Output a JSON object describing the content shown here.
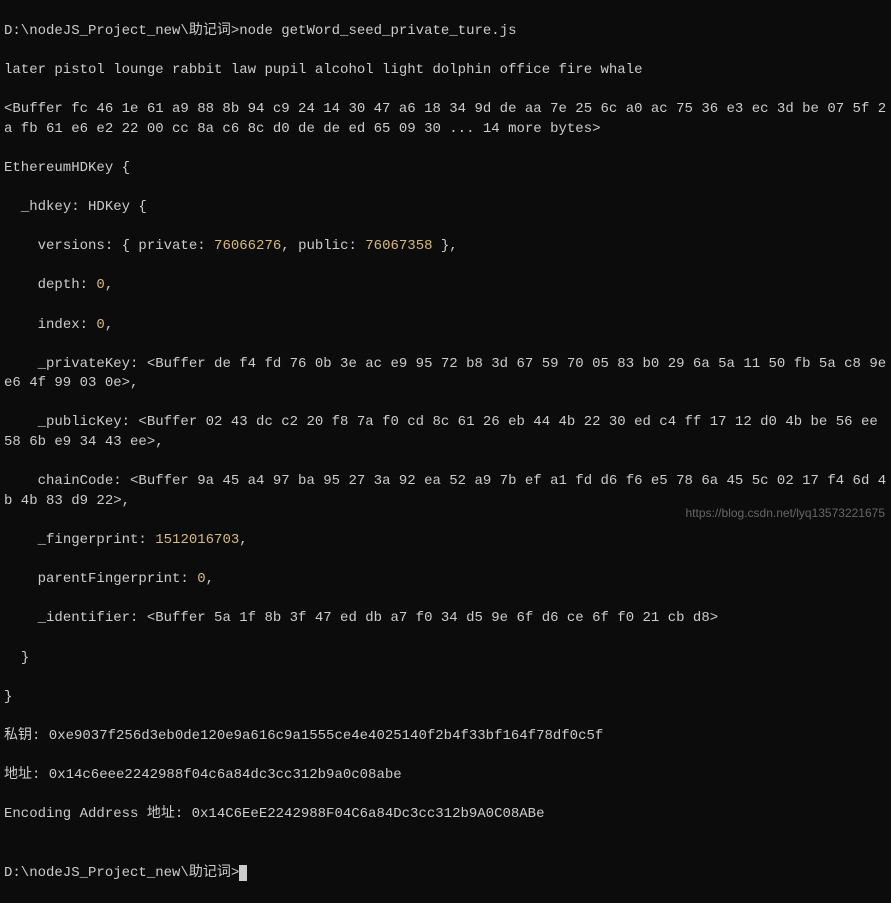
{
  "prompt1": "D:\\nodeJS_Project_new\\助记词>",
  "command": "node getWord_seed_private_ture.js",
  "mnemonic": "later pistol lounge rabbit law pupil alcohol light dolphin office fire whale",
  "buffer1": "<Buffer fc 46 1e 61 a9 88 8b 94 c9 24 14 30 47 a6 18 34 9d de aa 7e 25 6c a0 ac 75 36 e3 ec 3d be 07 5f 2a fb 61 e6 e2 22 00 cc 8a c6 8c d0 de de ed 65 09 30 ... 14 more bytes>",
  "objHeader": "EthereumHDKey {",
  "hdkeyLine": "  _hdkey: HDKey {",
  "versionsPre": "    versions: { private: ",
  "versionsNum1": "76066276",
  "versionsMid": ", public: ",
  "versionsNum2": "76067358",
  "versionsPost": " },",
  "depthPre": "    depth: ",
  "depthVal": "0",
  "depthPost": ",",
  "indexPre": "    index: ",
  "indexVal": "0",
  "indexPost": ",",
  "privKeyLine": "    _privateKey: <Buffer de f4 fd 76 0b 3e ac e9 95 72 b8 3d 67 59 70 05 83 b0 29 6a 5a 11 50 fb 5a c8 9e e6 4f 99 03 0e>,",
  "pubKeyLine": "    _publicKey: <Buffer 02 43 dc c2 20 f8 7a f0 cd 8c 61 26 eb 44 4b 22 30 ed c4 ff 17 12 d0 4b be 56 ee 58 6b e9 34 43 ee>,",
  "chainCodeLine": "    chainCode: <Buffer 9a 45 a4 97 ba 95 27 3a 92 ea 52 a9 7b ef a1 fd d6 f6 e5 78 6a 45 5c 02 17 f4 6d 4b 4b 83 d9 22>,",
  "fpPre": "    _fingerprint: ",
  "fpVal": "1512016703",
  "fpPost": ",",
  "parentFpPre": "    parentFingerprint: ",
  "parentFpVal": "0",
  "parentFpPost": ",",
  "identifierLine": "    _identifier: <Buffer 5a 1f 8b 3f 47 ed db a7 f0 34 d5 9e 6f d6 ce 6f f0 21 cb d8>",
  "closeInner": "  }",
  "closeOuter": "}",
  "privLabel": "私钥: 0xe9037f256d3eb0de120e9a616c9a1555ce4e4025140f2b4f33bf164f78df0c5f",
  "addrLabel": "地址: 0x14c6eee2242988f04c6a84dc3cc312b9a0c08abe",
  "encAddr": "Encoding Address 地址: 0x14C6EeE2242988F04C6a84Dc3cc312b9A0C08ABe",
  "blank": "",
  "prompt2": "D:\\nodeJS_Project_new\\助记词>",
  "watermark": "https://blog.csdn.net/lyq13573221675"
}
